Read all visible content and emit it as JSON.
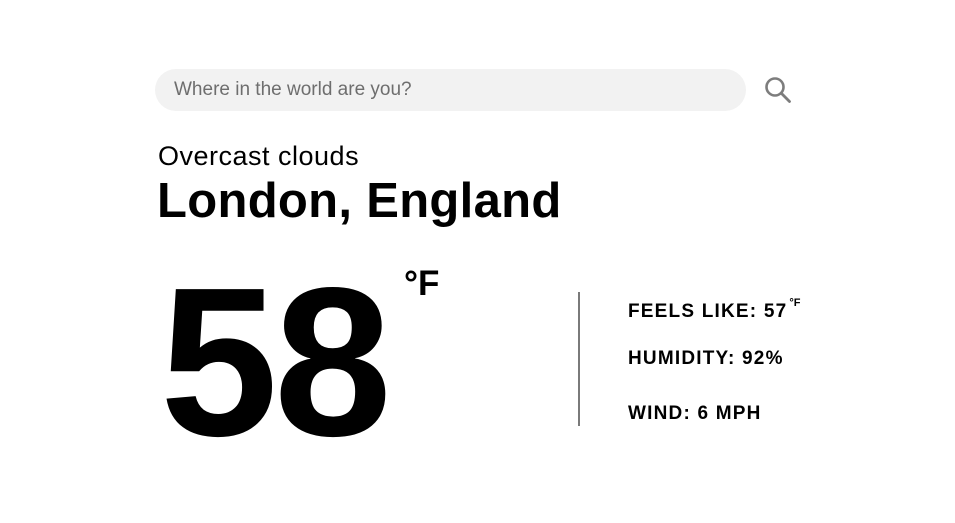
{
  "search": {
    "placeholder": "Where in the world are you?",
    "icon": "search-icon"
  },
  "weather": {
    "condition": "Overcast clouds",
    "location": "London, England",
    "temperature": "58",
    "temperature_unit": "°F"
  },
  "stats": {
    "feels_like_label": "FEELS LIKE:",
    "feels_like_value": "57",
    "feels_like_unit": "°F",
    "humidity_label": "HUMIDITY:",
    "humidity_value": "92%",
    "wind_label": "WIND:",
    "wind_value": "6 MPH"
  },
  "colors": {
    "background": "#ffffff",
    "search_background": "#f2f2f2",
    "text": "#000000",
    "muted_text": "#6e6e6e",
    "divider": "#7a7a7a"
  }
}
